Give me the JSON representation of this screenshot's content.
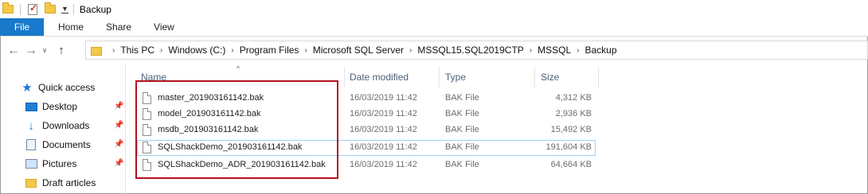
{
  "window": {
    "title": "Backup"
  },
  "ribbon": {
    "file_tab": "File",
    "tabs": [
      "Home",
      "Share",
      "View"
    ]
  },
  "address": {
    "crumbs": [
      "This PC",
      "Windows (C:)",
      "Program Files",
      "Microsoft SQL Server",
      "MSSQL15.SQL2019CTP",
      "MSSQL",
      "Backup"
    ]
  },
  "sidebar": {
    "items": [
      {
        "label": "Quick access",
        "icon": "star-icon"
      },
      {
        "label": "Desktop",
        "icon": "desktop-icon",
        "pinned": true
      },
      {
        "label": "Downloads",
        "icon": "download-icon",
        "pinned": true
      },
      {
        "label": "Documents",
        "icon": "documents-icon",
        "pinned": true
      },
      {
        "label": "Pictures",
        "icon": "pictures-icon",
        "pinned": true
      },
      {
        "label": "Draft articles",
        "icon": "folder-icon",
        "pinned": false
      }
    ]
  },
  "columns": {
    "name": "Name",
    "date": "Date modified",
    "type": "Type",
    "size": "Size"
  },
  "files": [
    {
      "name": "master_201903161142.bak",
      "date": "16/03/2019 11:42",
      "type": "BAK File",
      "size": "4,312 KB"
    },
    {
      "name": "model_201903161142.bak",
      "date": "16/03/2019 11:42",
      "type": "BAK File",
      "size": "2,936 KB"
    },
    {
      "name": "msdb_201903161142.bak",
      "date": "16/03/2019 11:42",
      "type": "BAK File",
      "size": "15,492 KB"
    },
    {
      "name": "SQLShackDemo_201903161142.bak",
      "date": "16/03/2019 11:42",
      "type": "BAK File",
      "size": "191,604 KB"
    },
    {
      "name": "SQLShackDemo_ADR_201903161142.bak",
      "date": "16/03/2019 11:42",
      "type": "BAK File",
      "size": "64,664 KB"
    }
  ],
  "colors": {
    "file_tab": "#1979ca",
    "highlight_border": "#b4121b",
    "hover_row": "#99d1f7"
  }
}
